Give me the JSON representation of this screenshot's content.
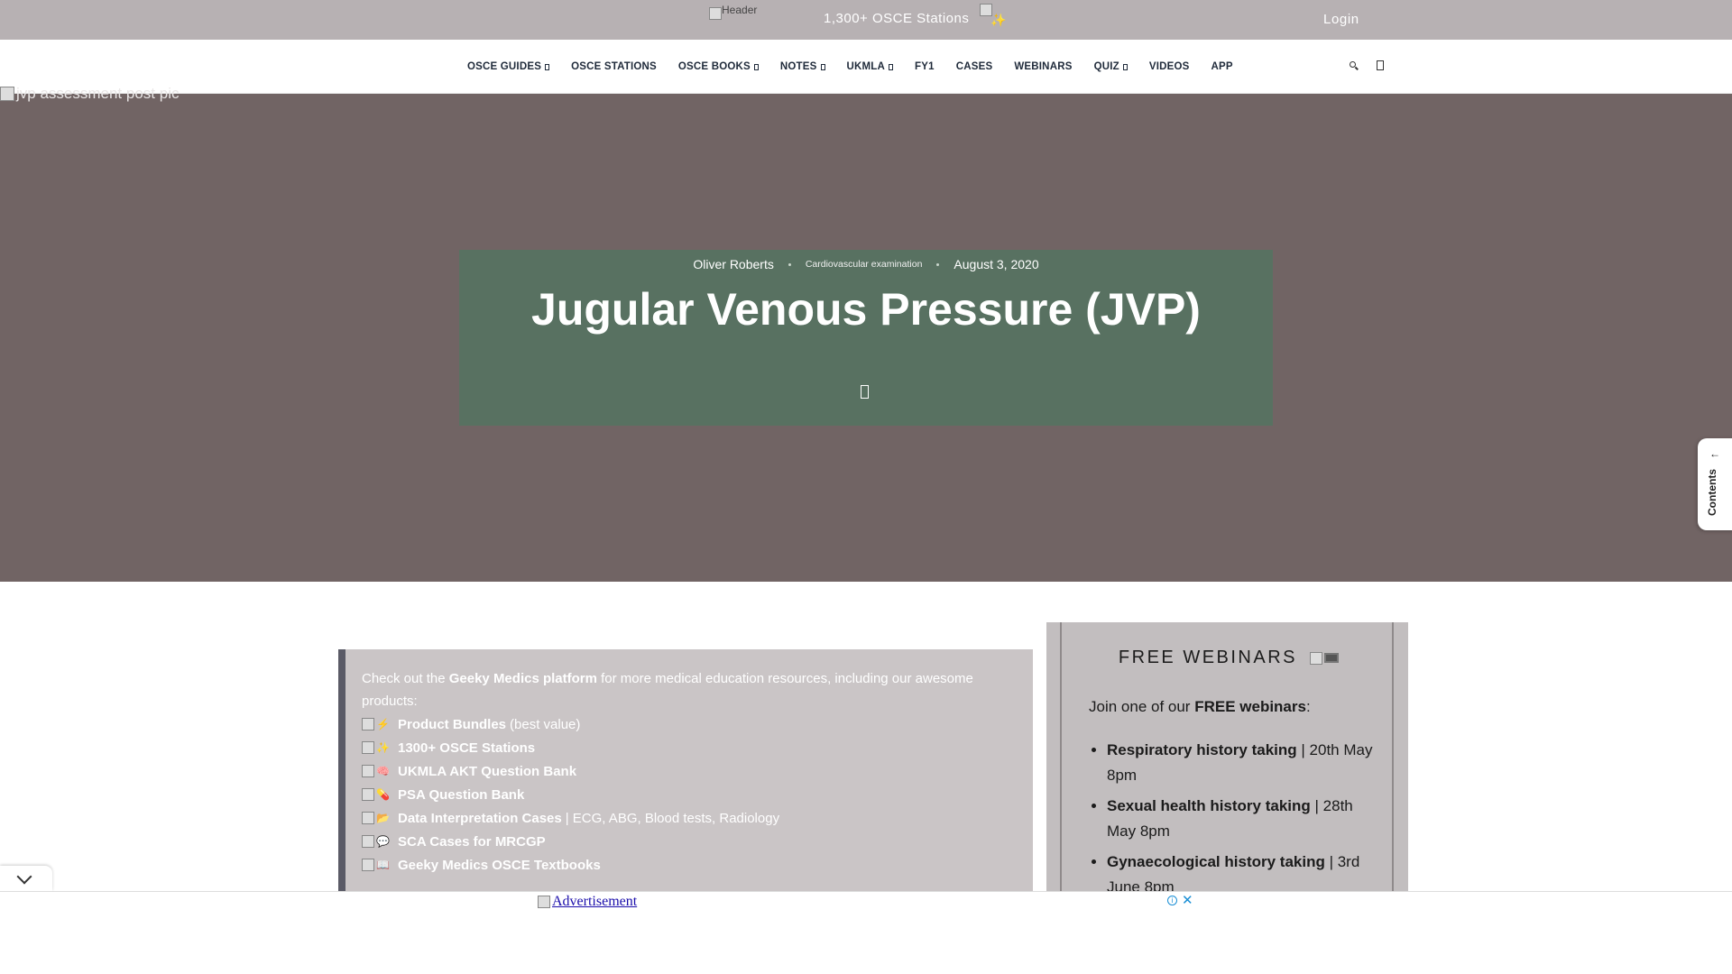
{
  "topbar": {
    "logo_alt": "Header",
    "promo_text": "1,300+ OSCE Stations",
    "promo_icon": "sparkles-icon",
    "login_label": "Login"
  },
  "nav": {
    "items": [
      {
        "label": "OSCE GUIDES",
        "dropdown": true
      },
      {
        "label": "OSCE STATIONS",
        "dropdown": false
      },
      {
        "label": "OSCE BOOKS",
        "dropdown": true
      },
      {
        "label": "NOTES",
        "dropdown": true
      },
      {
        "label": "UKMLA",
        "dropdown": true
      },
      {
        "label": "FY1",
        "dropdown": false
      },
      {
        "label": "CASES",
        "dropdown": false
      },
      {
        "label": "WEBINARS",
        "dropdown": false
      },
      {
        "label": "QUIZ",
        "dropdown": true
      },
      {
        "label": "VIDEOS",
        "dropdown": false
      },
      {
        "label": "APP",
        "dropdown": false
      }
    ]
  },
  "hero": {
    "image_alt": "jvp assessment post pic",
    "author": "Oliver Roberts",
    "category": "Cardiovascular examination",
    "date": "August 3, 2020",
    "title": "Jugular Venous Pressure (JVP)"
  },
  "contents_tab": {
    "label": "Contents",
    "arrow": "←"
  },
  "resources": {
    "intro_pre": "Check out the ",
    "intro_bold": "Geeky Medics platform",
    "intro_post": " for more medical education resources, including our awesome products:",
    "items": [
      {
        "icon": "lightning-icon",
        "glyph": "⚡",
        "label": "Product Bundles",
        "extra": "(best value)"
      },
      {
        "icon": "sparkles-icon",
        "glyph": "✨",
        "label": "1300+ OSCE Stations",
        "extra": ""
      },
      {
        "icon": "brain-icon",
        "glyph": "🧠",
        "label": "UKMLA AKT Question Bank",
        "extra": ""
      },
      {
        "icon": "pill-icon",
        "glyph": "💊",
        "label": "PSA Question Bank",
        "extra": ""
      },
      {
        "icon": "folder-icon",
        "glyph": "📂",
        "label": "Data Interpretation Cases",
        "extra": "| ECG, ABG, Blood tests, Radiology"
      },
      {
        "icon": "speech-bubble-icon",
        "glyph": "💬",
        "label": "SCA Cases for MRCGP",
        "extra": ""
      },
      {
        "icon": "book-icon",
        "glyph": "📖",
        "label": "Geeky Medics OSCE Textbooks",
        "extra": ""
      }
    ]
  },
  "webinars": {
    "title": "FREE WEBINARS",
    "intro_pre": "Join one of our ",
    "intro_bold": "FREE webinars",
    "intro_post": ":",
    "items": [
      {
        "title": "Respiratory history taking",
        "when": "| 20th May 8pm"
      },
      {
        "title": "Sexual health history taking",
        "when": "| 28th May 8pm"
      },
      {
        "title": "Gynaecological history taking",
        "when": "| 3rd June 8pm"
      }
    ]
  },
  "ad": {
    "label": "Advertisement",
    "info": "i",
    "close": "✕"
  }
}
